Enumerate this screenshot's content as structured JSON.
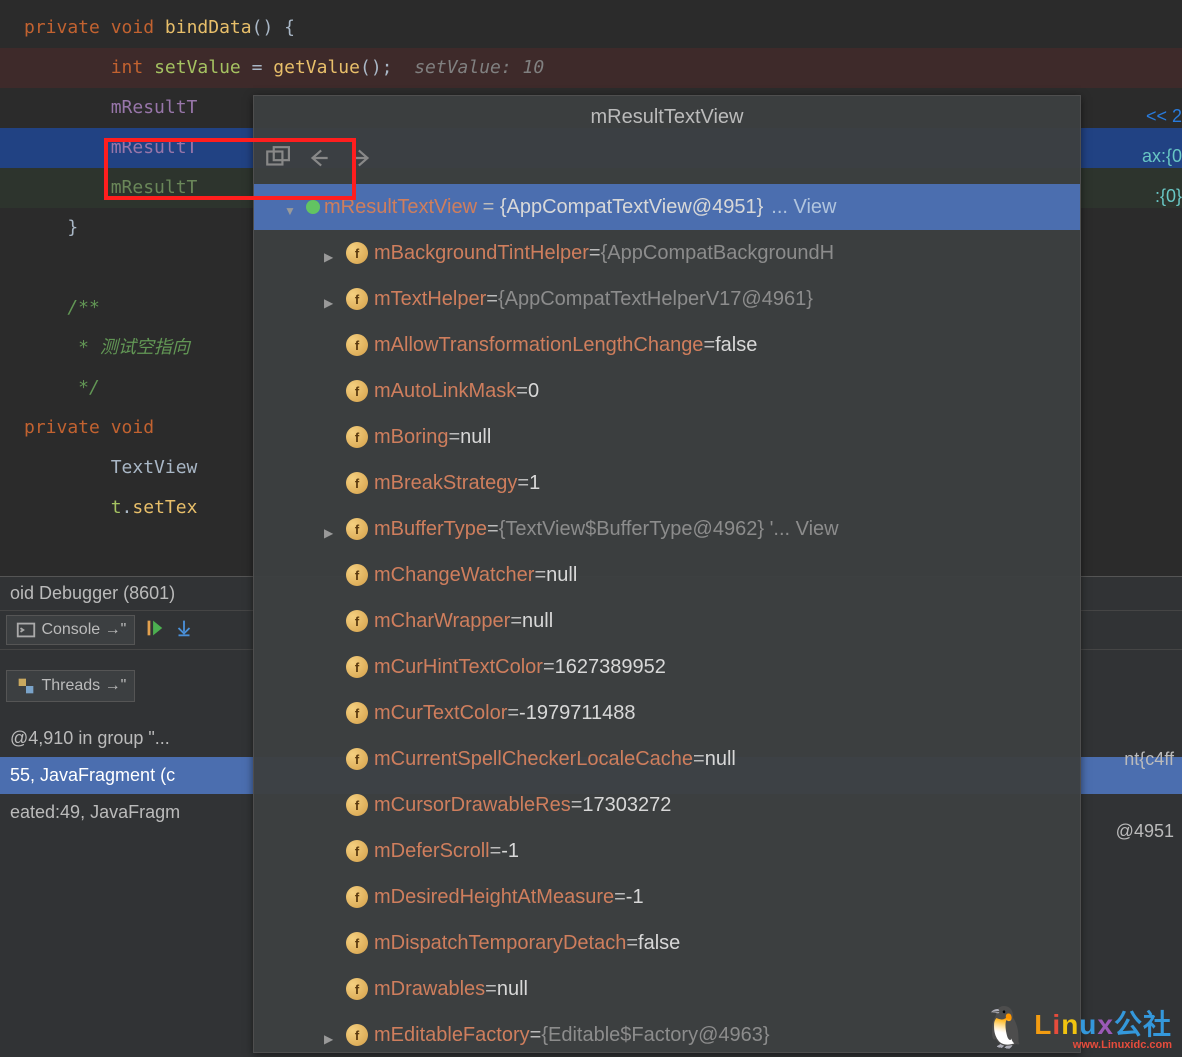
{
  "code": {
    "l1_private": "private",
    "l1_void": "void",
    "l1_method": "bindData",
    "l1_paren": "() {",
    "l2_int": "int",
    "l2_var": "setValue",
    "l2_eq": " = ",
    "l2_call": "getValue",
    "l2_end": "();",
    "l2_hint": "setValue: 10",
    "l3_pre": "        ",
    "l3_m": "mResultT",
    "l4_m": "mResultT",
    "l5_m": "mResultT",
    "l6": "    }",
    "l8": "    /**",
    "l9": "     * 测试空指向",
    "l10": "     */",
    "l11_private": "private",
    "l11_void": "void",
    "l12": "        TextView",
    "l13_pre": "        ",
    "l13_t": "t",
    "l13_dot": ".",
    "l13_m": "setTex"
  },
  "rightAnn": {
    "a1": "<< 2",
    "a2": "ax:{0",
    "a3": ":{0}"
  },
  "popup": {
    "title": "mResultTextView",
    "root_name": "mResultTextView",
    "root_val": "{AppCompatTextView@4951}",
    "root_trail": "... View",
    "fields": [
      {
        "arrow": "collapsed",
        "name": "mBackgroundTintHelper",
        "eq": " = ",
        "valType": "gray",
        "val": "{AppCompatBackgroundH"
      },
      {
        "arrow": "collapsed",
        "name": "mTextHelper",
        "eq": " = ",
        "valType": "gray",
        "val": "{AppCompatTextHelperV17@4961}"
      },
      {
        "arrow": "none",
        "name": "mAllowTransformationLengthChange",
        "eq": " = ",
        "valType": "white",
        "val": "false"
      },
      {
        "arrow": "none",
        "name": "mAutoLinkMask",
        "eq": " = ",
        "valType": "white",
        "val": "0"
      },
      {
        "arrow": "none",
        "name": "mBoring",
        "eq": " = ",
        "valType": "white",
        "val": "null"
      },
      {
        "arrow": "none",
        "name": "mBreakStrategy",
        "eq": " = ",
        "valType": "white",
        "val": "1"
      },
      {
        "arrow": "collapsed",
        "name": "mBufferType",
        "eq": " = ",
        "valType": "gray",
        "val": "{TextView$BufferType@4962} '... View",
        "view": true
      },
      {
        "arrow": "none",
        "name": "mChangeWatcher",
        "eq": " = ",
        "valType": "white",
        "val": "null"
      },
      {
        "arrow": "none",
        "name": "mCharWrapper",
        "eq": " = ",
        "valType": "white",
        "val": "null"
      },
      {
        "arrow": "none",
        "name": "mCurHintTextColor",
        "eq": " = ",
        "valType": "white",
        "val": "1627389952"
      },
      {
        "arrow": "none",
        "name": "mCurTextColor",
        "eq": " = ",
        "valType": "white",
        "val": "-1979711488"
      },
      {
        "arrow": "none",
        "name": "mCurrentSpellCheckerLocaleCache",
        "eq": " = ",
        "valType": "white",
        "val": "null"
      },
      {
        "arrow": "none",
        "name": "mCursorDrawableRes",
        "eq": " = ",
        "valType": "white",
        "val": "17303272"
      },
      {
        "arrow": "none",
        "name": "mDeferScroll",
        "eq": " = ",
        "valType": "white",
        "val": "-1"
      },
      {
        "arrow": "none",
        "name": "mDesiredHeightAtMeasure",
        "eq": " = ",
        "valType": "white",
        "val": "-1"
      },
      {
        "arrow": "none",
        "name": "mDispatchTemporaryDetach",
        "eq": " = ",
        "valType": "white",
        "val": "false"
      },
      {
        "arrow": "none",
        "name": "mDrawables",
        "eq": " = ",
        "valType": "white",
        "val": "null"
      },
      {
        "arrow": "collapsed",
        "name": "mEditableFactory",
        "eq": " = ",
        "valType": "gray",
        "val": "{Editable$Factory@4963}"
      }
    ]
  },
  "debugger": {
    "title": "oid Debugger (8601)",
    "console": "Console",
    "threads": "Threads",
    "row1": "@4,910 in group \"...",
    "row2": "55, JavaFragment (c",
    "row3": "eated:49, JavaFragm",
    "rightText1": "nt{c4ff",
    "rightText2": "@4951"
  },
  "watermark": {
    "sub": "www.Linuxidc.com"
  }
}
